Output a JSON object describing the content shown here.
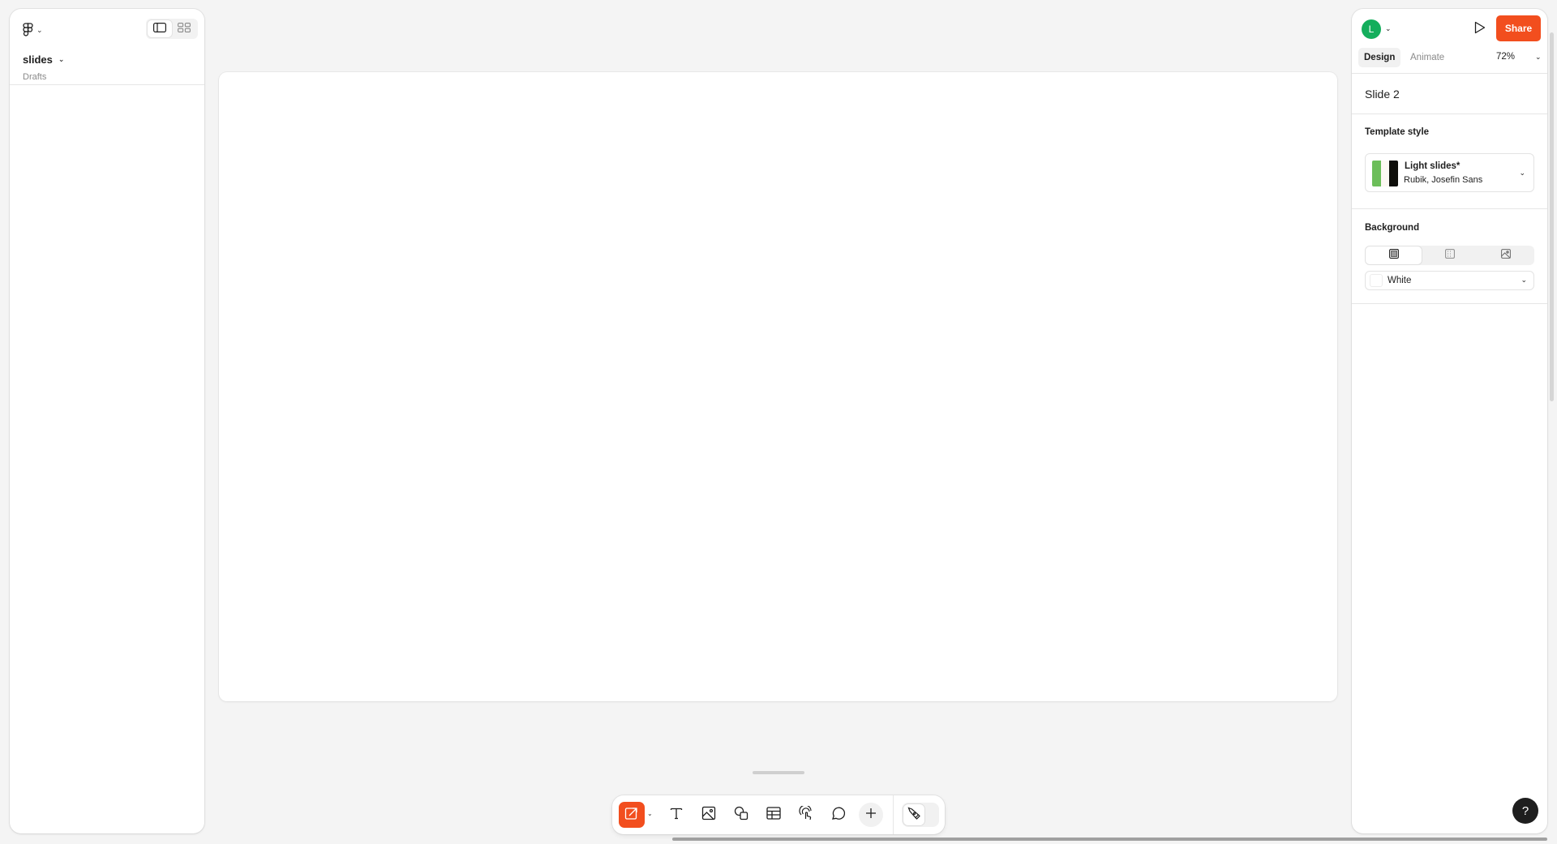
{
  "left_panel": {
    "logo_icon": "figma-logo-icon",
    "file_name": "slides",
    "file_location": "Drafts",
    "view_toggle": [
      {
        "name": "single-slide-view",
        "icon": "panel-left-icon",
        "active": true
      },
      {
        "name": "grid-view",
        "icon": "grid-icon",
        "active": false
      }
    ]
  },
  "toolbar": {
    "tools": [
      {
        "name": "slide-tool",
        "icon": "slide-arrow-icon",
        "active": true
      },
      {
        "name": "text-tool",
        "icon": "text-icon"
      },
      {
        "name": "image-tool",
        "icon": "image-icon"
      },
      {
        "name": "shape-tool",
        "icon": "shapes-icon"
      },
      {
        "name": "table-tool",
        "icon": "table-icon"
      },
      {
        "name": "interactive-tool",
        "icon": "tap-hand-icon"
      },
      {
        "name": "comment-tool",
        "icon": "comment-icon"
      },
      {
        "name": "more-tool",
        "icon": "plus-icon"
      }
    ],
    "mode_toggle": {
      "icon": "pen-icon",
      "state": "design"
    }
  },
  "right_panel": {
    "avatar_initial": "L",
    "avatar_color": "#14ae5c",
    "share_label": "Share",
    "accent_color": "#f24e1e",
    "tabs": [
      {
        "label": "Design",
        "active": true
      },
      {
        "label": "Animate",
        "active": false
      }
    ],
    "zoom": "72%",
    "slide_title": "Slide 2",
    "template_style": {
      "heading": "Template style",
      "name": "Light slides*",
      "fonts": "Rubik, Josefin Sans",
      "swatch_colors": [
        "#6cbe5a",
        "#fdf8f4",
        "#0e0e0a"
      ]
    },
    "background": {
      "heading": "Background",
      "fill_types": [
        {
          "name": "solid",
          "icon": "solid-fill-icon",
          "active": true
        },
        {
          "name": "pattern",
          "icon": "pattern-fill-icon",
          "active": false
        },
        {
          "name": "image",
          "icon": "image-fill-icon",
          "active": false
        }
      ],
      "value": "White",
      "color": "#ffffff"
    },
    "help_label": "?"
  }
}
